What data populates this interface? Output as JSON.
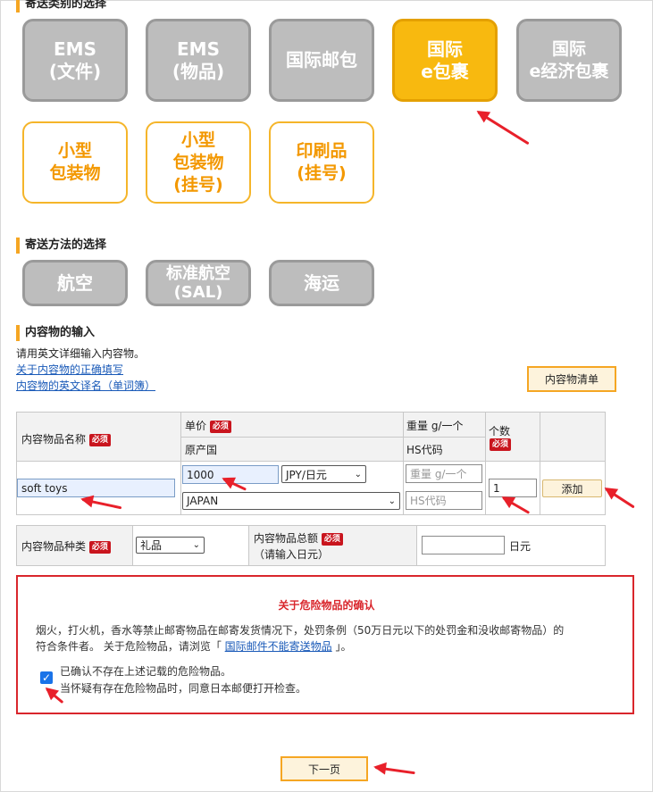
{
  "sections": {
    "category_title": "寄送类别的选择",
    "method_title": "寄送方法的选择",
    "contents_title": "内容物的输入"
  },
  "category_tiles": [
    {
      "label": "EMS\n(文件)",
      "state": "disabled"
    },
    {
      "label": "EMS\n(物品)",
      "state": "disabled"
    },
    {
      "label": "国际邮包",
      "state": "disabled"
    },
    {
      "label": "国际\ne包裹",
      "state": "selected"
    },
    {
      "label": "国际\ne经济包裹",
      "state": "disabled"
    },
    {
      "label": "小型\n包装物",
      "state": "available"
    },
    {
      "label": "小型\n包装物\n(挂号)",
      "state": "available"
    },
    {
      "label": "印刷品\n(挂号)",
      "state": "available"
    }
  ],
  "method_tiles": [
    {
      "label": "航空",
      "state": "disabled"
    },
    {
      "label": "标准航空\n(SAL)",
      "state": "disabled"
    },
    {
      "label": "海运",
      "state": "disabled"
    }
  ],
  "contents": {
    "instruction": "请用英文详细输入内容物。",
    "link_correct": "关于内容物的正确填写",
    "link_glossary": "内容物的英文译名（单词簿）",
    "list_button": "内容物清单"
  },
  "item_table": {
    "col_name": "内容物品名称",
    "col_price": "单价",
    "col_origin": "原产国",
    "col_weight": "重量 g/一个",
    "col_hs": "HS代码",
    "col_qty": "个数",
    "required_badge": "必须",
    "name_value": "soft toys",
    "price_value": "1000",
    "currency": "JPY/日元",
    "country": "JAPAN",
    "weight_placeholder": "重量 g/一个",
    "hs_placeholder": "HS代码",
    "qty_value": "1",
    "add_button": "添加"
  },
  "category_table": {
    "label_type": "内容物品种类",
    "type_value": "礼品",
    "label_total": "内容物品总额",
    "label_total_note": "（请输入日元）",
    "total_value": "",
    "unit": "日元"
  },
  "danger": {
    "title": "关于危险物品的确认",
    "body_line1": "烟火，打火机，香水等禁止邮寄物品在邮寄发货情况下，处罚条例（50万日元以下的处罚金和没收邮寄物品）的",
    "body_line2_prefix": "符合条件者。 关于危险物品，请浏览「 ",
    "body_link": "国际邮件不能寄送物品",
    "body_line2_suffix": " 」。",
    "confirm_line1": "已确认不存在上述记载的危险物品。",
    "confirm_line2": "当怀疑有存在危险物品时，同意日本邮便打开检查。",
    "checked": true
  },
  "next_button": "下一页",
  "colors": {
    "accent": "#f5a623",
    "selected": "#f8b90f",
    "danger": "#d9262c",
    "arrow": "#e8202a"
  }
}
